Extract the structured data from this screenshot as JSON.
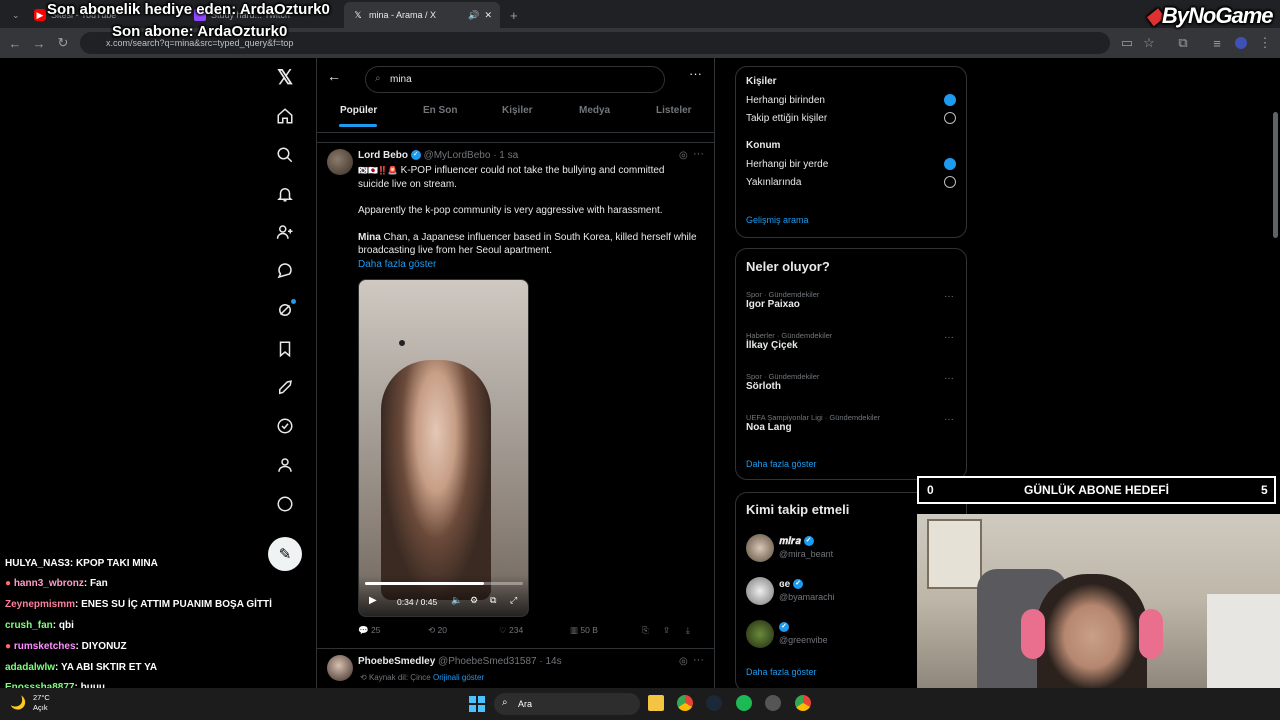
{
  "browser": {
    "tabs": [
      {
        "label": "Sitesi - YouTube"
      },
      {
        "label": "Study hard... Twitch"
      },
      {
        "label": "mina - Arama / X"
      }
    ],
    "url": "x.com/search?q=mina&src=typed_query&f=top"
  },
  "stream_overlay": {
    "gift_line": "Son abonelik hediye eden: ArdaOzturk0",
    "last_sub": "Son abone: ArdaOzturk0",
    "logo": "ByNoGame",
    "goal": {
      "current": "0",
      "label": "GÜNLÜK ABONE HEDEFİ",
      "target": "5"
    }
  },
  "search": {
    "value": "mina",
    "tabs": [
      "Popüler",
      "En Son",
      "Kişiler",
      "Medya",
      "Listeler"
    ]
  },
  "tweet": {
    "author": "Lord Bebo",
    "handle": "@MyLordBebo",
    "time": "· 1 sa",
    "line1": "K-POP influencer could not take the bullying and committed suicide live on stream.",
    "line2": "Apparently the k-pop community is very aggressive with harassment.",
    "line3_bold": "Mina",
    "line3": " Chan, a Japanese influencer based in South Korea, killed herself while broadcasting live from her Seoul apartment.",
    "show_more": "Daha fazla göster",
    "video_time": "0:34 / 0:45",
    "video_progress": 0.75,
    "replies": "25",
    "retweets": "20",
    "likes": "234",
    "views": "50 B"
  },
  "tweet2": {
    "author": "PhoebeSmedley",
    "handle": "@PhoebeSmed31587",
    "time": "· 14s",
    "source_label": "Kaynak dil: Çince",
    "source_link": "Orijinali göster"
  },
  "filters": {
    "people_title": "Kişiler",
    "people": [
      {
        "label": "Herhangi birinden",
        "selected": true
      },
      {
        "label": "Takip ettiğin kişiler",
        "selected": false
      }
    ],
    "location_title": "Konum",
    "locations": [
      {
        "label": "Herhangi bir yerde",
        "selected": true
      },
      {
        "label": "Yakınlarında",
        "selected": false
      }
    ],
    "advanced": "Gelişmiş arama"
  },
  "trends": {
    "title": "Neler oluyor?",
    "items": [
      {
        "category": "Spor · Gündemdekiler",
        "name": "Igor Paixao"
      },
      {
        "category": "Haberler · Gündemdekiler",
        "name": "İlkay Çiçek"
      },
      {
        "category": "Spor · Gündemdekiler",
        "name": "Sörloth"
      },
      {
        "category": "UEFA Şampiyonlar Ligi · Gündemdekiler",
        "name": "Noa Lang"
      }
    ],
    "show_more": "Daha fazla göster"
  },
  "follow": {
    "title": "Kimi takip etmeli",
    "items": [
      {
        "name": "𝒎𝒊𝒓𝒂",
        "handle": "@mira_beant"
      },
      {
        "name": "ɞe",
        "handle": "@byamarachi"
      },
      {
        "name": "",
        "handle": "@greenvibe"
      }
    ],
    "show_more": "Daha fazla göster"
  },
  "chat": [
    {
      "user": "HULYA_NAS3",
      "msg": ": KPOP TAKI MINA",
      "color": "#ffffff"
    },
    {
      "user": "hann3_wbronz",
      "msg": ": Fan",
      "color": "#ff9ecb"
    },
    {
      "user": "Zeynepmismm",
      "msg": ": ENES SU İÇ ATTIM PUANIM BOŞA GİTTİ",
      "color": "#ff7f9f"
    },
    {
      "user": "crush_fan",
      "msg": ": qbi",
      "color": "#7fff7f"
    },
    {
      "user": "rumsketches",
      "msg": ": DIYONUZ",
      "color": "#ff8fff"
    },
    {
      "user": "adadalwlw",
      "msg": ": YA ABI SKTIR ET YA",
      "color": "#7fff7f"
    },
    {
      "user": "Enosssha8877",
      "msg": ": buuu",
      "color": "#7fff7f"
    }
  ],
  "taskbar": {
    "search": "Ara",
    "weather_temp": "27°C",
    "weather_desc": "Açık"
  }
}
